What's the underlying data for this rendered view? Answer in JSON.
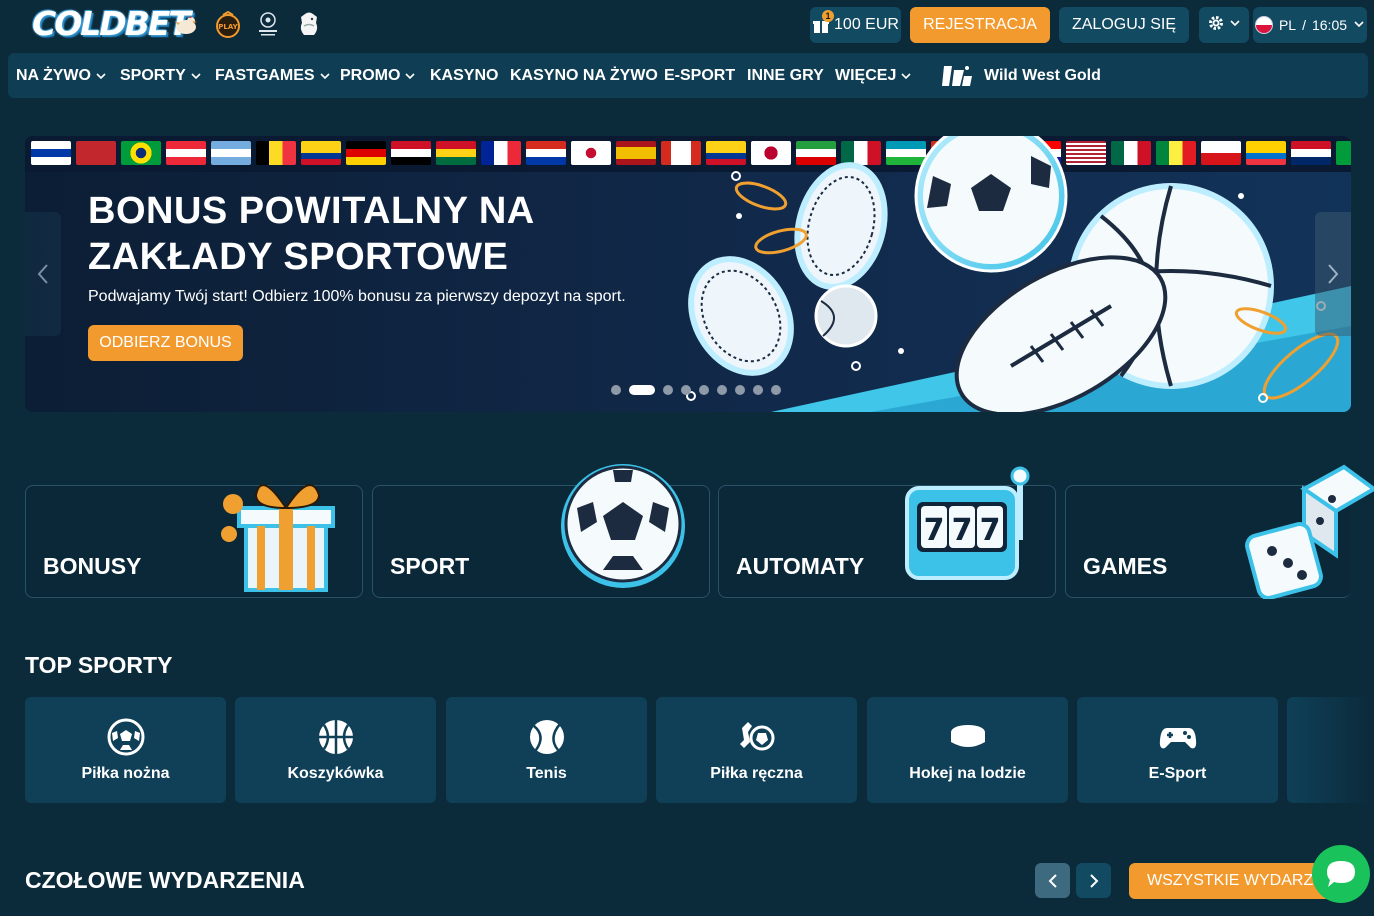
{
  "header": {
    "brand": "COLDBET",
    "partners": [
      "chicken-logo-icon",
      "play-logo-icon",
      "champions-league-icon",
      "premier-league-icon"
    ],
    "bonus_amount": "100 EUR",
    "bonus_badge": "1",
    "register_label": "REJESTRACJA",
    "login_label": "ZALOGUJ SIĘ",
    "language": "PL",
    "time": "16:05"
  },
  "nav": {
    "items": [
      {
        "label": "NA ŻYWO",
        "dropdown": true
      },
      {
        "label": "SPORTY",
        "dropdown": true
      },
      {
        "label": "FASTGAMES",
        "dropdown": true
      },
      {
        "label": "PROMO",
        "dropdown": true
      },
      {
        "label": "KASYNO",
        "dropdown": false
      },
      {
        "label": "KASYNO NA ŻYWO",
        "dropdown": false
      },
      {
        "label": "E-SPORT",
        "dropdown": false
      },
      {
        "label": "INNE GRY",
        "dropdown": false
      },
      {
        "label": "WIĘCEJ",
        "dropdown": true
      }
    ],
    "special_label": "Wild West Gold"
  },
  "banner": {
    "title": "BONUS POWITALNY NA ZAKŁADY SPORTOWE",
    "subtitle": "Podwajamy Twój start! Odbierz 100% bonusu za pierwszy depozyt na sport.",
    "cta_label": "ODBIERZ BONUS",
    "slides_total": 9,
    "active_slide": 2
  },
  "categories": [
    {
      "label": "BONUSY",
      "icon": "gift-icon"
    },
    {
      "label": "SPORT",
      "icon": "soccer-ball-icon"
    },
    {
      "label": "AUTOMATY",
      "icon": "slot-machine-icon"
    },
    {
      "label": "GAMES",
      "icon": "dice-icon"
    }
  ],
  "top_sports": {
    "title": "TOP SPORTY",
    "items": [
      {
        "label": "Piłka nożna",
        "icon": "soccer-icon"
      },
      {
        "label": "Koszykówka",
        "icon": "basketball-icon"
      },
      {
        "label": "Tenis",
        "icon": "tennis-icon"
      },
      {
        "label": "Piłka ręczna",
        "icon": "handball-icon"
      },
      {
        "label": "Hokej na lodzie",
        "icon": "hockey-puck-icon"
      },
      {
        "label": "E-Sport",
        "icon": "gamepad-icon"
      }
    ]
  },
  "events": {
    "title": "CZOŁOWE WYDARZENIA",
    "all_label": "WSZYSTKIE WYDARZENIA"
  },
  "colors": {
    "background": "#0b2a3a",
    "accent": "#f39a2e",
    "panel": "#124a62",
    "chat": "#19c25a"
  }
}
